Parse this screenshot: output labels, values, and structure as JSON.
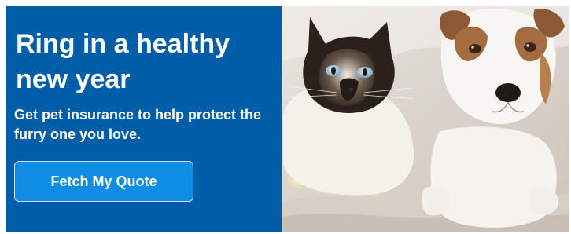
{
  "promo": {
    "headline": "Ring in a healthy new year",
    "subheadline": "Get pet insurance to help protect the furry one you love.",
    "cta_label": "Fetch My Quote",
    "panel_color": "#005da8",
    "cta_color": "#0d8de3"
  },
  "photo": {
    "subject": "cat-and-dog-photo"
  }
}
